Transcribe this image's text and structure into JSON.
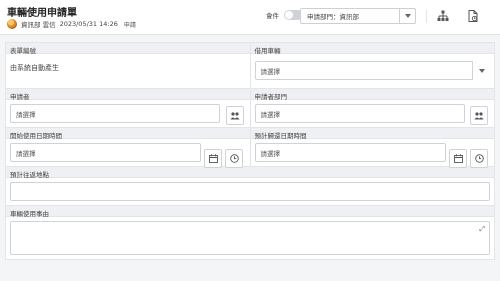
{
  "header": {
    "title": "車輛使用申請單",
    "author": "資訊部 雲信",
    "datetime": "2023/05/31 14:26",
    "status": "申請",
    "toggle_label": "會件",
    "dept_select": "申請部門：資訊部"
  },
  "form": {
    "form_no_label": "表單編號",
    "form_no_value": "由系統自動產生",
    "vehicle_label": "借用車輛",
    "vehicle_placeholder": "請選擇",
    "applicant_label": "申請者",
    "applicant_placeholder": "請選擇",
    "applicant_dept_label": "申請者部門",
    "applicant_dept_placeholder": "請選擇",
    "start_label": "開始使用日期時間",
    "start_placeholder": "請選擇",
    "return_label": "預計歸還日期時間",
    "return_placeholder": "請選擇",
    "destination_label": "預計往返地點",
    "reason_label": "車輛使用事由"
  },
  "icons": {
    "org_chart": "org-chart-icon",
    "document": "document-icon",
    "people": "people-icon",
    "calendar": "calendar-icon",
    "clock": "clock-icon",
    "expand": "expand-icon"
  }
}
